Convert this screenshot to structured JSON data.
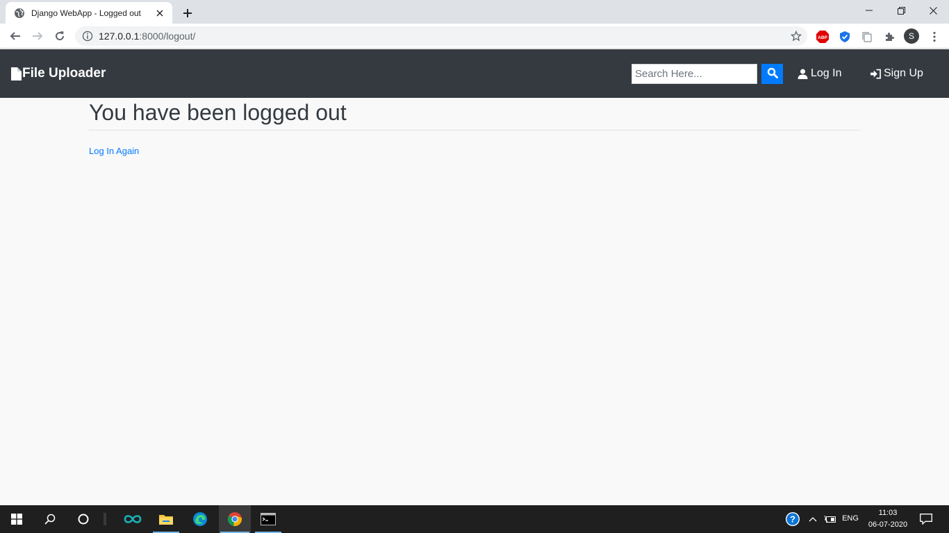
{
  "browser": {
    "tab_title": "Django WebApp - Logged out",
    "url_host": "127.0.0.1",
    "url_path": ":8000/logout/",
    "profile_initial": "S",
    "abp_label": "ABP"
  },
  "site": {
    "brand": "File Uploader",
    "search_placeholder": "Search Here...",
    "login_label": "Log In",
    "signup_label": "Sign Up",
    "accent_color": "#007bff",
    "navbar_color": "#343a40"
  },
  "main": {
    "title": "You have been logged out",
    "link_label": "Log In Again"
  },
  "taskbar": {
    "language": "ENG",
    "time": "11:03",
    "date": "06-07-2020",
    "help_glyph": "?"
  }
}
